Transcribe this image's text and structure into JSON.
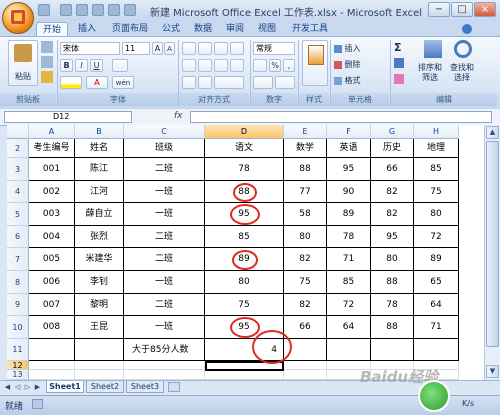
{
  "window": {
    "title": "新建 Microsoft Office Excel 工作表.xlsx - Microsoft Excel",
    "minimize": "−",
    "maximize": "□",
    "close": "×"
  },
  "tabs": [
    "开始",
    "插入",
    "页面布局",
    "公式",
    "数据",
    "审阅",
    "视图",
    "开发工具"
  ],
  "ribbon": {
    "clipboard": {
      "paste": "粘贴",
      "label": "剪贴板"
    },
    "font": {
      "name": "宋体",
      "size": "11",
      "bold": "B",
      "italic": "I",
      "underline": "U",
      "grow": "A",
      "shrink": "A",
      "font_color": "A",
      "phonetic": "wén",
      "label": "字体"
    },
    "alignment": {
      "label": "对齐方式"
    },
    "number": {
      "format": "常规",
      "percent": "%",
      "comma": ",",
      "label": "数字"
    },
    "styles": {
      "label": "样式"
    },
    "cells": {
      "insert": "插入",
      "delete": "删除",
      "format": "格式",
      "label": "单元格"
    },
    "editing": {
      "sigma": "Σ",
      "sort": "排序和",
      "sort2": "筛选",
      "find": "查找和",
      "find2": "选择",
      "label": "编辑"
    }
  },
  "formula_bar": {
    "name_box": "D12",
    "fx": "fx",
    "content": ""
  },
  "columns": [
    "A",
    "B",
    "C",
    "D",
    "E",
    "F",
    "G",
    "H"
  ],
  "row_numbers": [
    "2",
    "3",
    "4",
    "5",
    "6",
    "7",
    "8",
    "9",
    "10",
    "11",
    "12",
    "13"
  ],
  "table": {
    "headers": [
      "考生编号",
      "姓名",
      "班级",
      "语文",
      "数学",
      "英语",
      "历史",
      "地理"
    ],
    "rows": [
      [
        "001",
        "陈江",
        "二班",
        "78",
        "88",
        "95",
        "66",
        "85"
      ],
      [
        "002",
        "江河",
        "一班",
        "88",
        "77",
        "90",
        "82",
        "75"
      ],
      [
        "003",
        "薛自立",
        "一班",
        "95",
        "58",
        "89",
        "82",
        "80"
      ],
      [
        "004",
        "张烈",
        "二班",
        "85",
        "80",
        "78",
        "95",
        "72"
      ],
      [
        "005",
        "米建华",
        "二班",
        "89",
        "82",
        "71",
        "80",
        "89"
      ],
      [
        "006",
        "李钊",
        "一班",
        "80",
        "75",
        "85",
        "88",
        "65"
      ],
      [
        "007",
        "黎明",
        "二班",
        "75",
        "82",
        "72",
        "78",
        "64"
      ],
      [
        "008",
        "王昆",
        "一班",
        "95",
        "66",
        "64",
        "88",
        "71"
      ]
    ],
    "summary_label": "大于85分人数",
    "summary_value": "4"
  },
  "sheet_tabs": [
    "Sheet1",
    "Sheet2",
    "Sheet3"
  ],
  "status": {
    "ready": "就绪",
    "zoom": "K/s"
  },
  "watermark": "Baidu经验"
}
